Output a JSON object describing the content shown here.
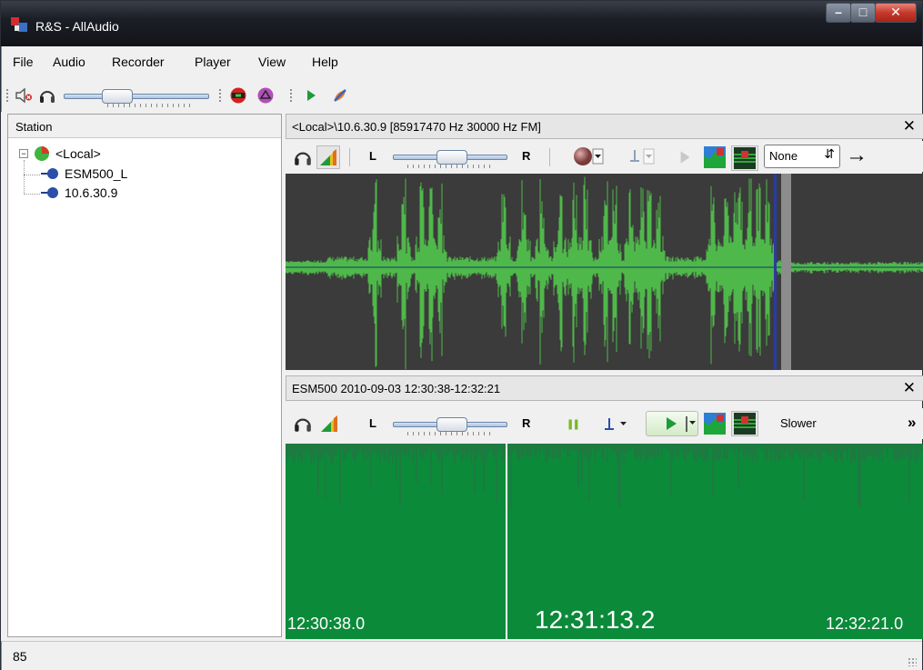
{
  "window": {
    "title": "R&S - AllAudio"
  },
  "menu": [
    "File",
    "Audio",
    "Recorder",
    "Player",
    "View",
    "Help"
  ],
  "station_panel": {
    "header": "Station",
    "tree": {
      "root": "<Local>",
      "children": [
        "ESM500_L",
        "10.6.30.9"
      ]
    }
  },
  "live_channel": {
    "title": "<Local>\\10.6.30.9  [85917470 Hz 30000 Hz FM]",
    "left_label": "L",
    "right_label": "R",
    "mode_select": "None",
    "volume_balance": 0.5
  },
  "recording_channel": {
    "title": "ESM500 2010-09-03 12:30:38-12:32:21",
    "left_label": "L",
    "right_label": "R",
    "speed_label": "Slower",
    "more": "»",
    "time_start": "12:30:38.0",
    "time_cursor": "12:31:13.2",
    "time_end": "12:32:21.0",
    "volume_balance": 0.5
  },
  "status": {
    "text": "85"
  },
  "colors": {
    "wave": "#4fb84a",
    "wave_bg": "#3b3b3b",
    "spectrum": "#0b8a3a",
    "cursor": "#2b3b9e"
  },
  "icons": [
    "app-icon",
    "speaker-mute-icon",
    "headphones-icon",
    "record-stop-icon",
    "rewind-icon",
    "play-icon",
    "color-palette-icon"
  ]
}
